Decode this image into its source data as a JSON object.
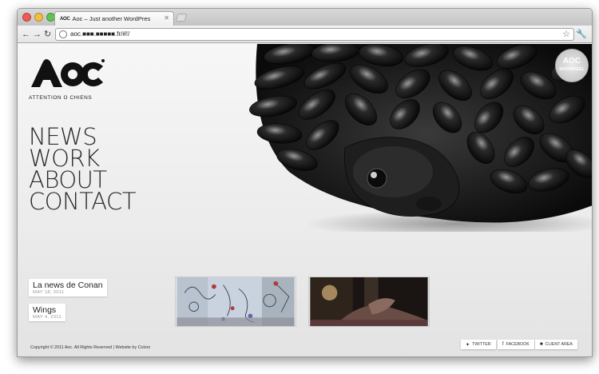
{
  "browser": {
    "tab_title": "Aoc – Just another WordPres",
    "tab_favicon": "AOC",
    "url": "aoc.■■■.■■■■■.fr/#!/",
    "nav_icons": {
      "back": "back-arrow-icon",
      "forward": "forward-arrow-icon",
      "reload": "reload-icon"
    }
  },
  "site": {
    "logo_text": "AOC",
    "tagline": "ATTENTION O CHIENS",
    "showreel_badge": {
      "top": "AOC",
      "bottom": "SHOWREEL"
    },
    "menu": [
      {
        "label": "NEWS"
      },
      {
        "label": "WORK"
      },
      {
        "label": "ABOUT"
      },
      {
        "label": "CONTACT"
      }
    ],
    "news": [
      {
        "title": "La news de Conan",
        "date": "MAY 18, 2011"
      },
      {
        "title": "Wings",
        "date": "MAY 4, 2011"
      }
    ],
    "footer": {
      "copyright": "Copyright © 2011 Aoc. All Rights Reserved | Website by Colorz",
      "buttons": [
        {
          "label": "TWITTER",
          "icon": "bird-icon"
        },
        {
          "label": "FACEBOOK",
          "icon": "facebook-icon"
        },
        {
          "label": "CLIENT AREA",
          "icon": "lock-icon"
        }
      ]
    }
  }
}
